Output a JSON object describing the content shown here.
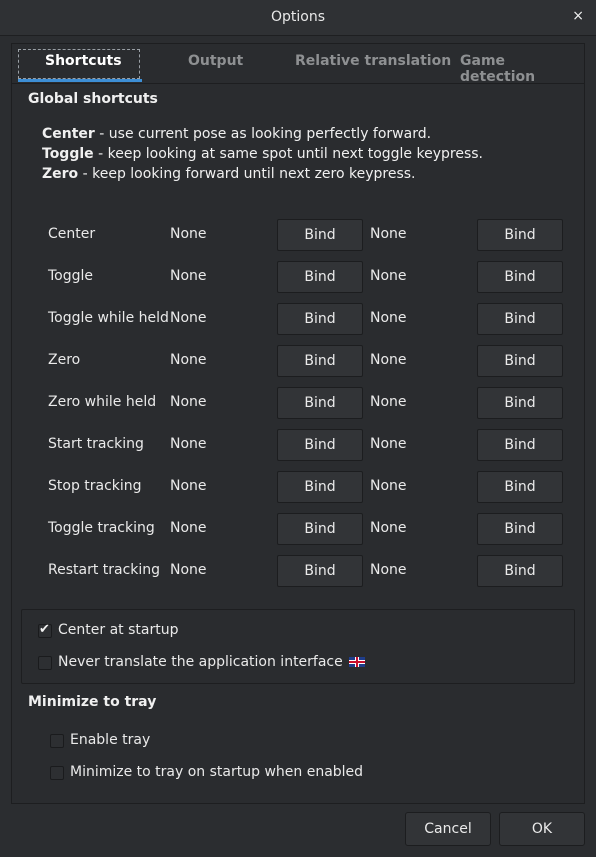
{
  "window": {
    "title": "Options",
    "close_glyph": "×"
  },
  "tabs": [
    {
      "label": "Shortcuts",
      "active": true
    },
    {
      "label": "Output",
      "active": false
    },
    {
      "label": "Relative translation",
      "active": false
    },
    {
      "label": "Game detection",
      "active": false
    }
  ],
  "global_shortcuts": {
    "title": "Global shortcuts",
    "descriptions": [
      {
        "term": "Center",
        "text": " - use current pose as looking perfectly forward."
      },
      {
        "term": "Toggle",
        "text": " - keep looking at same spot until next toggle keypress."
      },
      {
        "term": "Zero",
        "text": " - keep looking forward until next zero keypress."
      }
    ],
    "rows": [
      {
        "label": "Center",
        "key1": "None",
        "bind1": "Bind",
        "key2": "None",
        "bind2": "Bind"
      },
      {
        "label": "Toggle",
        "key1": "None",
        "bind1": "Bind",
        "key2": "None",
        "bind2": "Bind"
      },
      {
        "label": "Toggle while held",
        "key1": "None",
        "bind1": "Bind",
        "key2": "None",
        "bind2": "Bind"
      },
      {
        "label": "Zero",
        "key1": "None",
        "bind1": "Bind",
        "key2": "None",
        "bind2": "Bind"
      },
      {
        "label": "Zero while held",
        "key1": "None",
        "bind1": "Bind",
        "key2": "None",
        "bind2": "Bind"
      },
      {
        "label": "Start tracking",
        "key1": "None",
        "bind1": "Bind",
        "key2": "None",
        "bind2": "Bind"
      },
      {
        "label": "Stop tracking",
        "key1": "None",
        "bind1": "Bind",
        "key2": "None",
        "bind2": "Bind"
      },
      {
        "label": "Toggle tracking",
        "key1": "None",
        "bind1": "Bind",
        "key2": "None",
        "bind2": "Bind"
      },
      {
        "label": "Restart tracking",
        "key1": "None",
        "bind1": "Bind",
        "key2": "None",
        "bind2": "Bind"
      }
    ]
  },
  "options": {
    "center_at_startup": {
      "label": "Center at startup",
      "checked": true
    },
    "never_translate": {
      "label": "Never translate the application interface",
      "checked": false,
      "icon": "uk-flag-icon"
    }
  },
  "tray": {
    "title": "Minimize to tray",
    "enable_tray": {
      "label": "Enable tray",
      "checked": false
    },
    "minimize_on_startup": {
      "label": "Minimize to tray on startup when enabled",
      "checked": false
    }
  },
  "footer": {
    "cancel_label": "Cancel",
    "ok_label": "OK"
  },
  "colors": {
    "background": "#2b2d30",
    "accent": "#3d8fd6",
    "text": "#e6e6e6"
  }
}
